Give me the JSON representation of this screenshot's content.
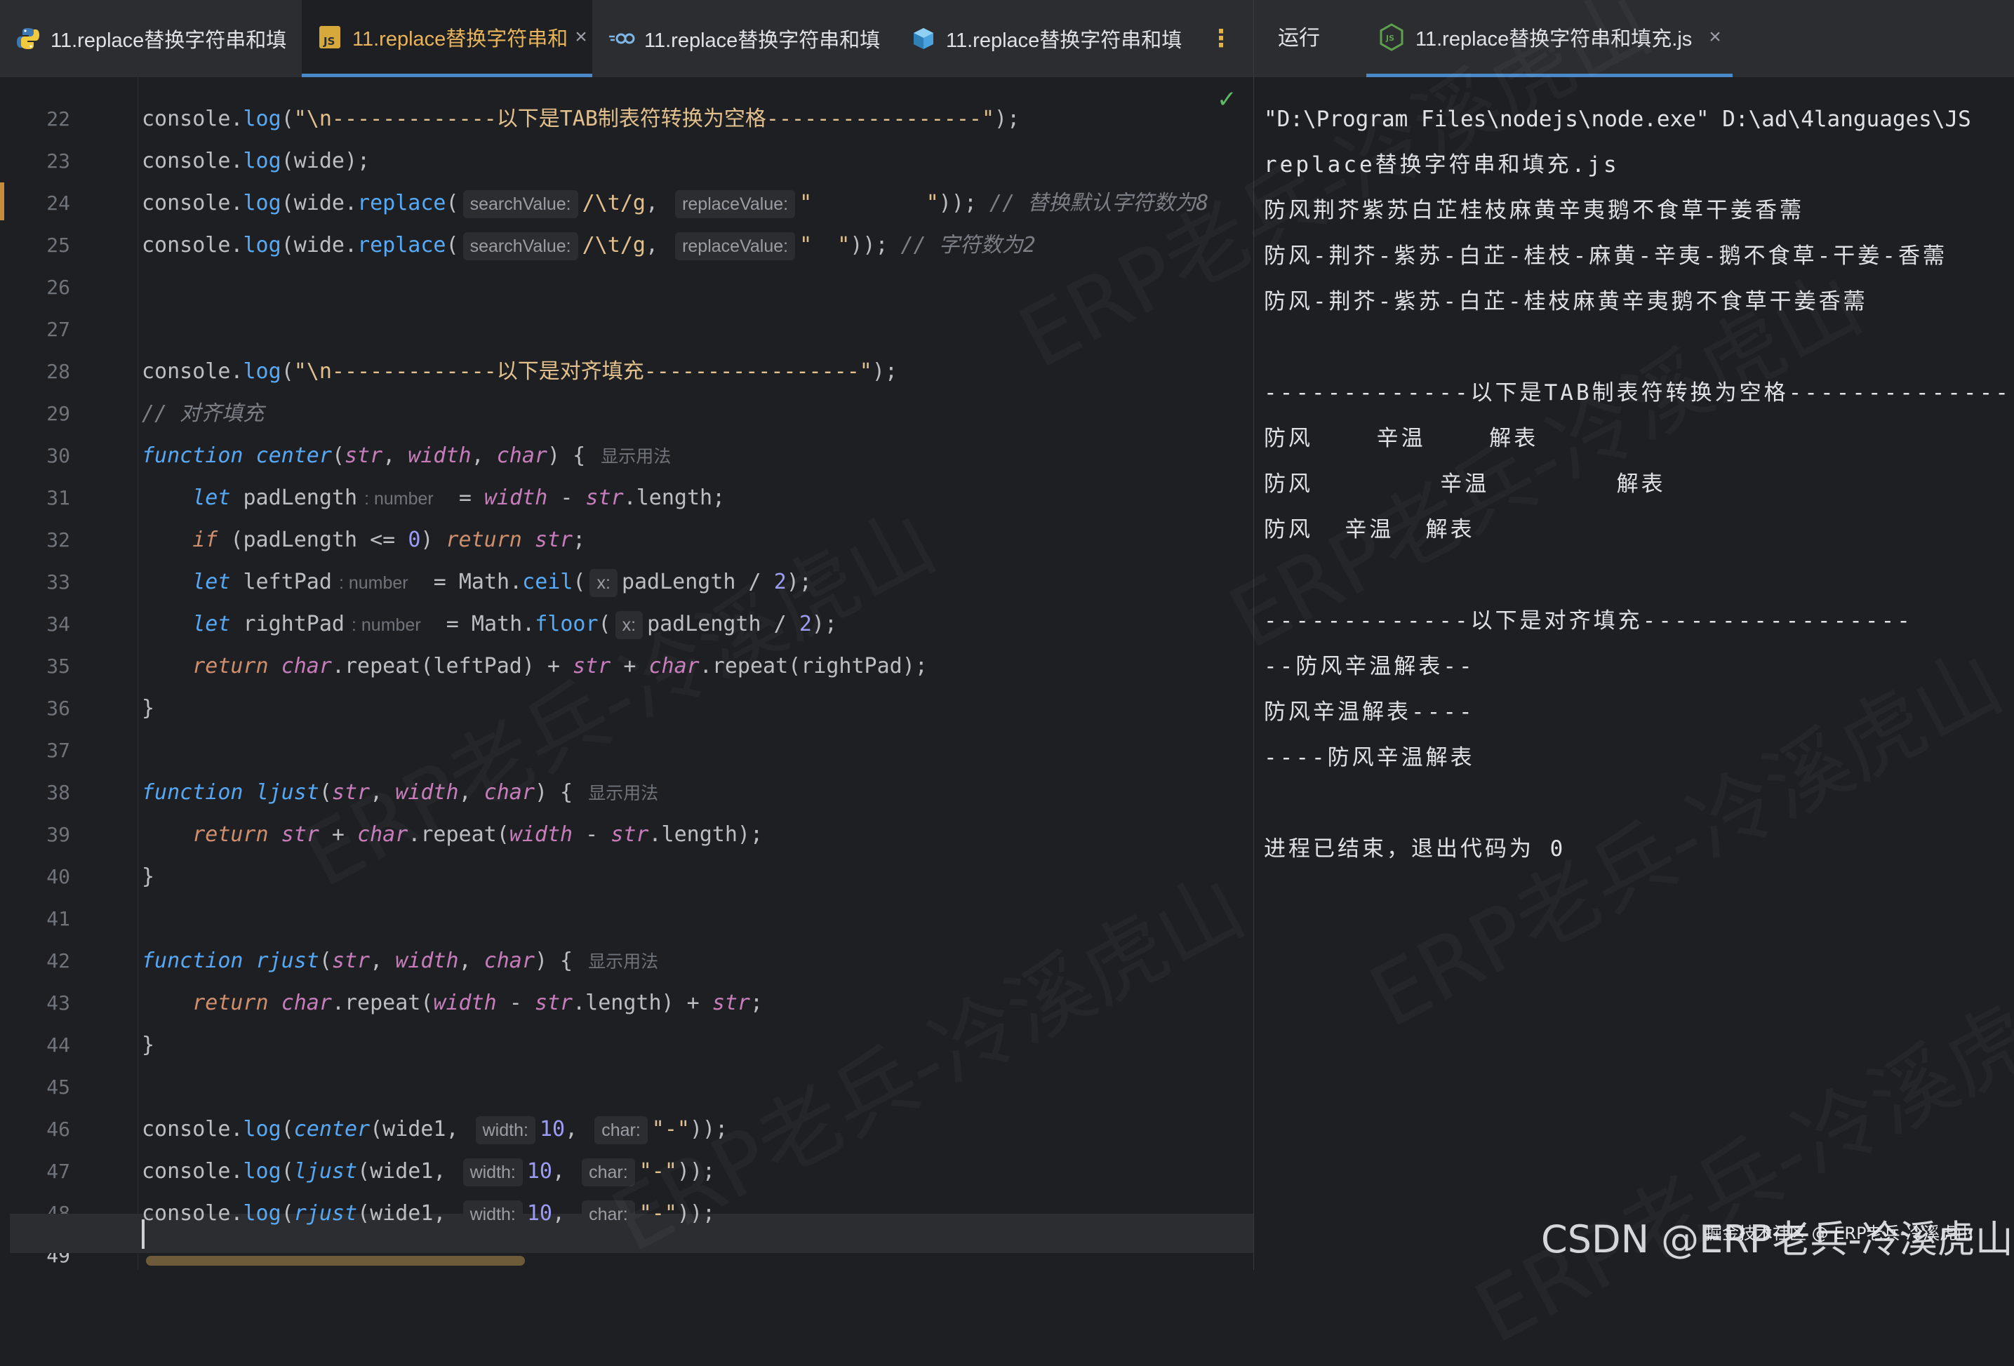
{
  "editor": {
    "tabs": [
      {
        "label": "11.replace替换字符串和填",
        "icon": "python-icon",
        "active": false
      },
      {
        "label": "11.replace替换字符串和",
        "icon": "js-file-icon",
        "active": true,
        "close": "×"
      },
      {
        "label": "11.replace替换字符串和填",
        "icon": "go-icon",
        "active": false
      },
      {
        "label": "11.replace替换字符串和填",
        "icon": "cube-icon",
        "active": false
      }
    ],
    "more_tabs": "⋮",
    "line_numbers": [
      "22",
      "23",
      "24",
      "25",
      "26",
      "27",
      "28",
      "29",
      "30",
      "31",
      "32",
      "33",
      "34",
      "35",
      "36",
      "37",
      "38",
      "39",
      "40",
      "41",
      "42",
      "43",
      "44",
      "45",
      "46",
      "47",
      "48",
      "49"
    ],
    "current_line": "49",
    "hints": {
      "search_value": "searchValue:",
      "replace_value": "replaceValue:",
      "number_type": ": number",
      "x": "x:",
      "width": "width:",
      "char": "char:",
      "usage": "显示用法"
    },
    "code": {
      "l22_str": "\"\\n-------------以下是TAB制表符转换为空格-----------------\"",
      "l24_regex": "/\\t/g",
      "l24_repl": "\"         \"",
      "l24_comment": "// 替换默认字符数为8",
      "l25_repl": "\"  \"",
      "l25_comment": "// 字符数为2",
      "l28_str": "\"\\n-------------以下是对齐填充-----------------\"",
      "l29_comment": "// 对齐填充",
      "num_zero": "0",
      "num_two": "2",
      "num_ten": "10",
      "dash_str": "\"-\""
    }
  },
  "run": {
    "label": "运行",
    "tab_label": "11.replace替换字符串和填充.js",
    "tab_icon": "nodejs-icon",
    "close": "×",
    "output": [
      "\"D:\\Program Files\\nodejs\\node.exe\" D:\\ad\\4languages\\JS",
      "replace替换字符串和填充.js",
      "防风荆芥紫苏白芷桂枝麻黄辛夷鹅不食草干姜香薷",
      "防风-荆芥-紫苏-白芷-桂枝-麻黄-辛夷-鹅不食草-干姜-香薷",
      "防风-荆芥-紫苏-白芷-桂枝麻黄辛夷鹅不食草干姜香薷",
      "",
      "-------------以下是TAB制表符转换为空格----------------",
      "防风    辛温    解表",
      "防风        辛温        解表",
      "防风  辛温  解表",
      "",
      "-------------以下是对齐填充-----------------",
      "--防风辛温解表--",
      "防风辛温解表----",
      "----防风辛温解表",
      "",
      "进程已结束，退出代码为 0"
    ]
  },
  "watermark": {
    "text": "ERP老兵-冷溪虎山",
    "csdn": "CSDN @ERP老兵-冷溪虎山",
    "juejin": "掘金技术社区 @ ERP老兵-冷溪虎山"
  }
}
